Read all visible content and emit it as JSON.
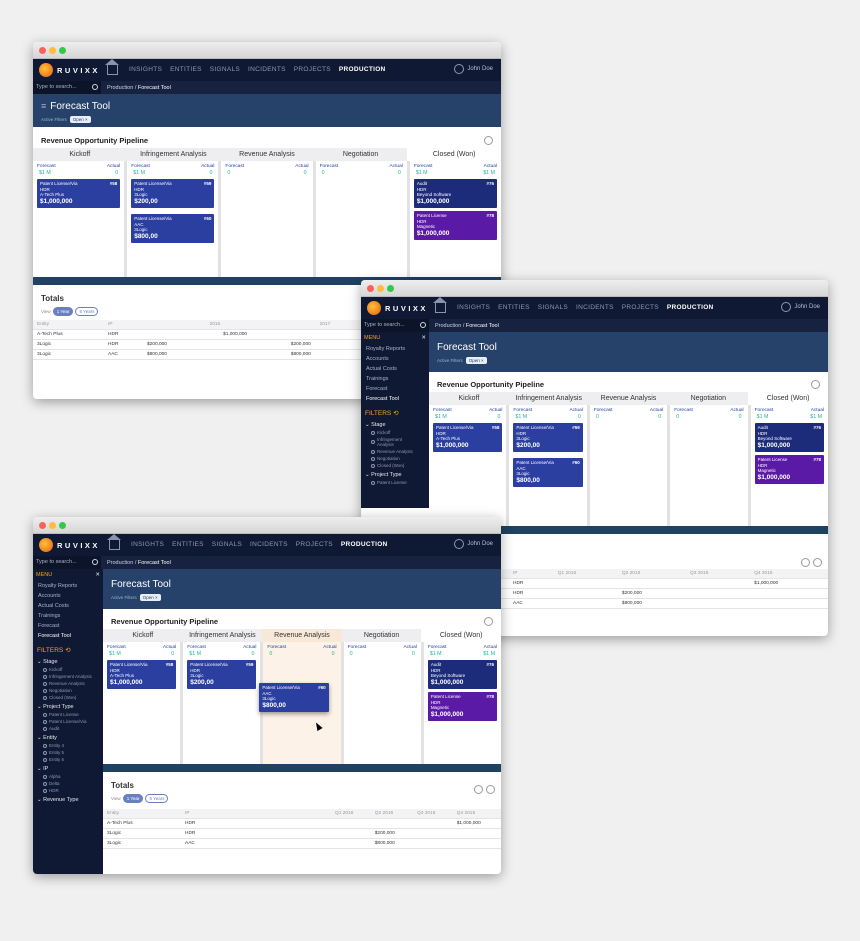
{
  "app": {
    "brand": "RUVIXX",
    "nav": [
      "INSIGHTS",
      "ENTITIES",
      "SIGNALS",
      "INCIDENTS",
      "PROJECTS",
      "PRODUCTION"
    ],
    "user": "John Doe",
    "search_placeholder": "Type to search...",
    "crumb_parent": "Production / ",
    "crumb_current": "Forecast Tool",
    "page_title": "Forecast Tool",
    "active_filters_label": "Active Filters",
    "filter_chip": "Open ×"
  },
  "pipeline": {
    "title": "Revenue Opportunity Pipeline",
    "stages": [
      "Kickoff",
      "Infringement Analysis",
      "Revenue Analysis",
      "Negotiation",
      "Closed (Won)"
    ],
    "forecast_label": "Forecast",
    "actual_label": "Actual",
    "columns": [
      {
        "forecast": "$1 M",
        "actual": "0"
      },
      {
        "forecast": "$1 M",
        "actual": "0"
      },
      {
        "forecast": "0",
        "actual": "0"
      },
      {
        "forecast": "0",
        "actual": "0"
      },
      {
        "forecast": "$1 M",
        "actual": "$1 M"
      }
    ],
    "cards": {
      "kickoff": {
        "type": "Patent License/Via",
        "id": "#58",
        "ip": "HDR",
        "entity": "A-Tech Plus",
        "amount": "$1,000,000"
      },
      "infr1": {
        "type": "Patent License/Via",
        "id": "#59",
        "ip": "HDR",
        "entity": "3Logic",
        "amount": "$200,00"
      },
      "infr2": {
        "type": "Patent License/Via",
        "id": "#60",
        "ip": "AAC",
        "entity": "3Logic",
        "amount": "$800,00"
      },
      "closed1": {
        "type": "Audit",
        "id": "#76",
        "ip": "HDR",
        "entity": "Beyond Software",
        "amount": "$1,000,000"
      },
      "closed2": {
        "type": "Patent License",
        "id": "#78",
        "ip": "HDR",
        "entity": "Magnetic",
        "amount": "$1,000,000"
      }
    }
  },
  "totals": {
    "title": "Totals",
    "view_label": "View",
    "view_opts": [
      "1 Year",
      "5 Years"
    ],
    "cols": [
      "Entity",
      "IP",
      "Q1 2016",
      "Q2 2016",
      "Q3 2016",
      "Q4 2016"
    ],
    "years": [
      "2016",
      "2017"
    ],
    "rows": [
      {
        "entity": "A-Tech Plus",
        "ip": "HDR",
        "q1": "",
        "q2": "",
        "q3": "",
        "q4": "$1,000,000"
      },
      {
        "entity": "3Logic",
        "ip": "HDR",
        "q1": "",
        "q2": "$200,000",
        "q3": "",
        "q4": ""
      },
      {
        "entity": "3Logic",
        "ip": "AAC",
        "q1": "",
        "q2": "$800,000",
        "q3": "",
        "q4": ""
      }
    ],
    "w1_q4_vals": [
      "$1,000,000",
      "$200,000",
      "$800,000"
    ]
  },
  "sidebar": {
    "menu": "MENU",
    "items": [
      "Royalty Reports",
      "Accounts",
      "Actual Costs",
      "Trainings",
      "Forecast",
      "Forecast Tool"
    ],
    "filters": "FILTERS",
    "groups": [
      {
        "title": "Stage",
        "opts": [
          "Kickoff",
          "Infringement Analysis",
          "Revenue Analysis",
          "Negotiation",
          "Closed (Won)"
        ]
      },
      {
        "title": "Project Type",
        "opts": [
          "Patent License",
          "Patent License/Via",
          "Audit"
        ]
      },
      {
        "title": "Entity",
        "opts": [
          "Entity 4",
          "Entity 5",
          "Entity 6"
        ]
      },
      {
        "title": "IP",
        "opts": [
          "Alpha",
          "Delta",
          "HDR"
        ]
      },
      {
        "title": "Revenue Type",
        "opts": []
      }
    ]
  }
}
